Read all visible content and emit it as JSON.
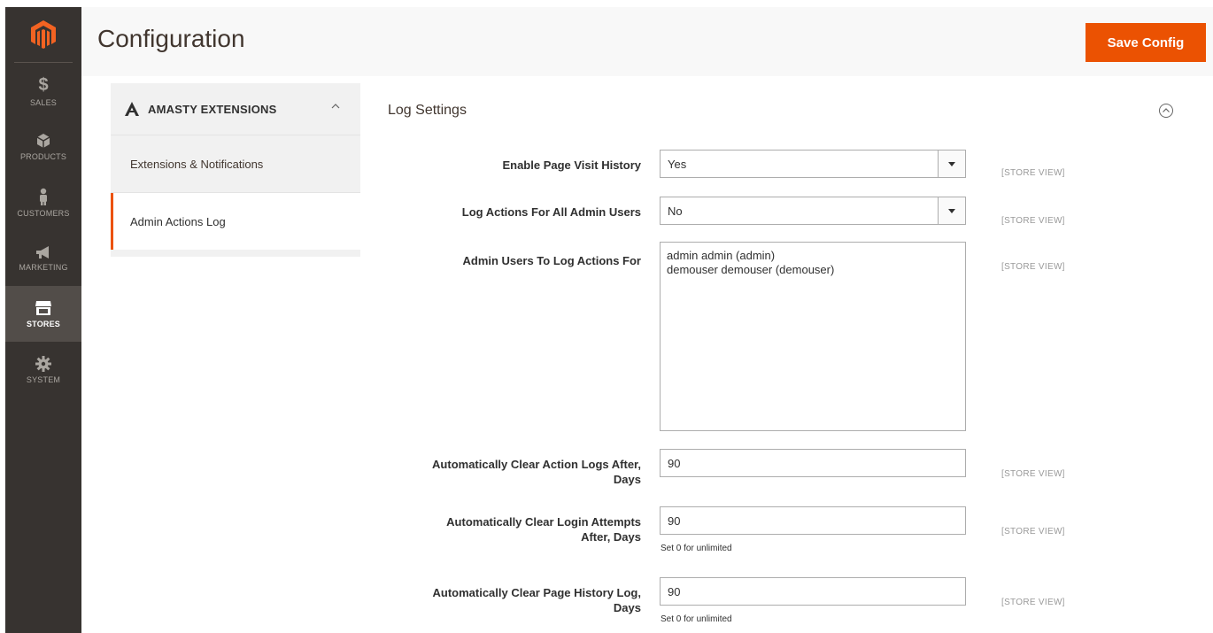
{
  "sidebar": {
    "items": [
      {
        "label": "SALES",
        "icon": "dollar-icon"
      },
      {
        "label": "PRODUCTS",
        "icon": "cube-icon"
      },
      {
        "label": "CUSTOMERS",
        "icon": "person-icon"
      },
      {
        "label": "MARKETING",
        "icon": "megaphone-icon"
      },
      {
        "label": "STORES",
        "icon": "store-icon"
      },
      {
        "label": "SYSTEM",
        "icon": "gear-icon"
      }
    ],
    "active": "STORES"
  },
  "header": {
    "title": "Configuration",
    "save_label": "Save Config"
  },
  "config_nav": {
    "section_label": "AMASTY EXTENSIONS",
    "items": [
      {
        "label": "Extensions & Notifications"
      },
      {
        "label": "Admin Actions Log"
      }
    ]
  },
  "form": {
    "fieldset_title": "Log Settings",
    "scope_label": "[STORE VIEW]",
    "enable_history": {
      "label": "Enable Page Visit History",
      "value": "Yes"
    },
    "log_all_users": {
      "label": "Log Actions For All Admin Users",
      "value": "No"
    },
    "admin_users": {
      "label": "Admin Users To Log Actions For",
      "options": [
        "admin admin (admin)",
        "demouser demouser (demouser)"
      ]
    },
    "clear_action_logs": {
      "label_line1": "Automatically Clear Action Logs After,",
      "label_line2": "Days",
      "value": "90"
    },
    "clear_login_attempts": {
      "label_line1": "Automatically Clear Login Attempts",
      "label_line2": "After, Days",
      "value": "90",
      "note": "Set 0 for unlimited"
    },
    "clear_page_history": {
      "label_line1": "Automatically Clear Page History Log,",
      "label_line2": "Days",
      "value": "90",
      "note": "Set 0 for unlimited"
    }
  },
  "colors": {
    "accent": "#eb5202",
    "sidebar_bg": "#373330",
    "sidebar_active": "#524d49"
  }
}
